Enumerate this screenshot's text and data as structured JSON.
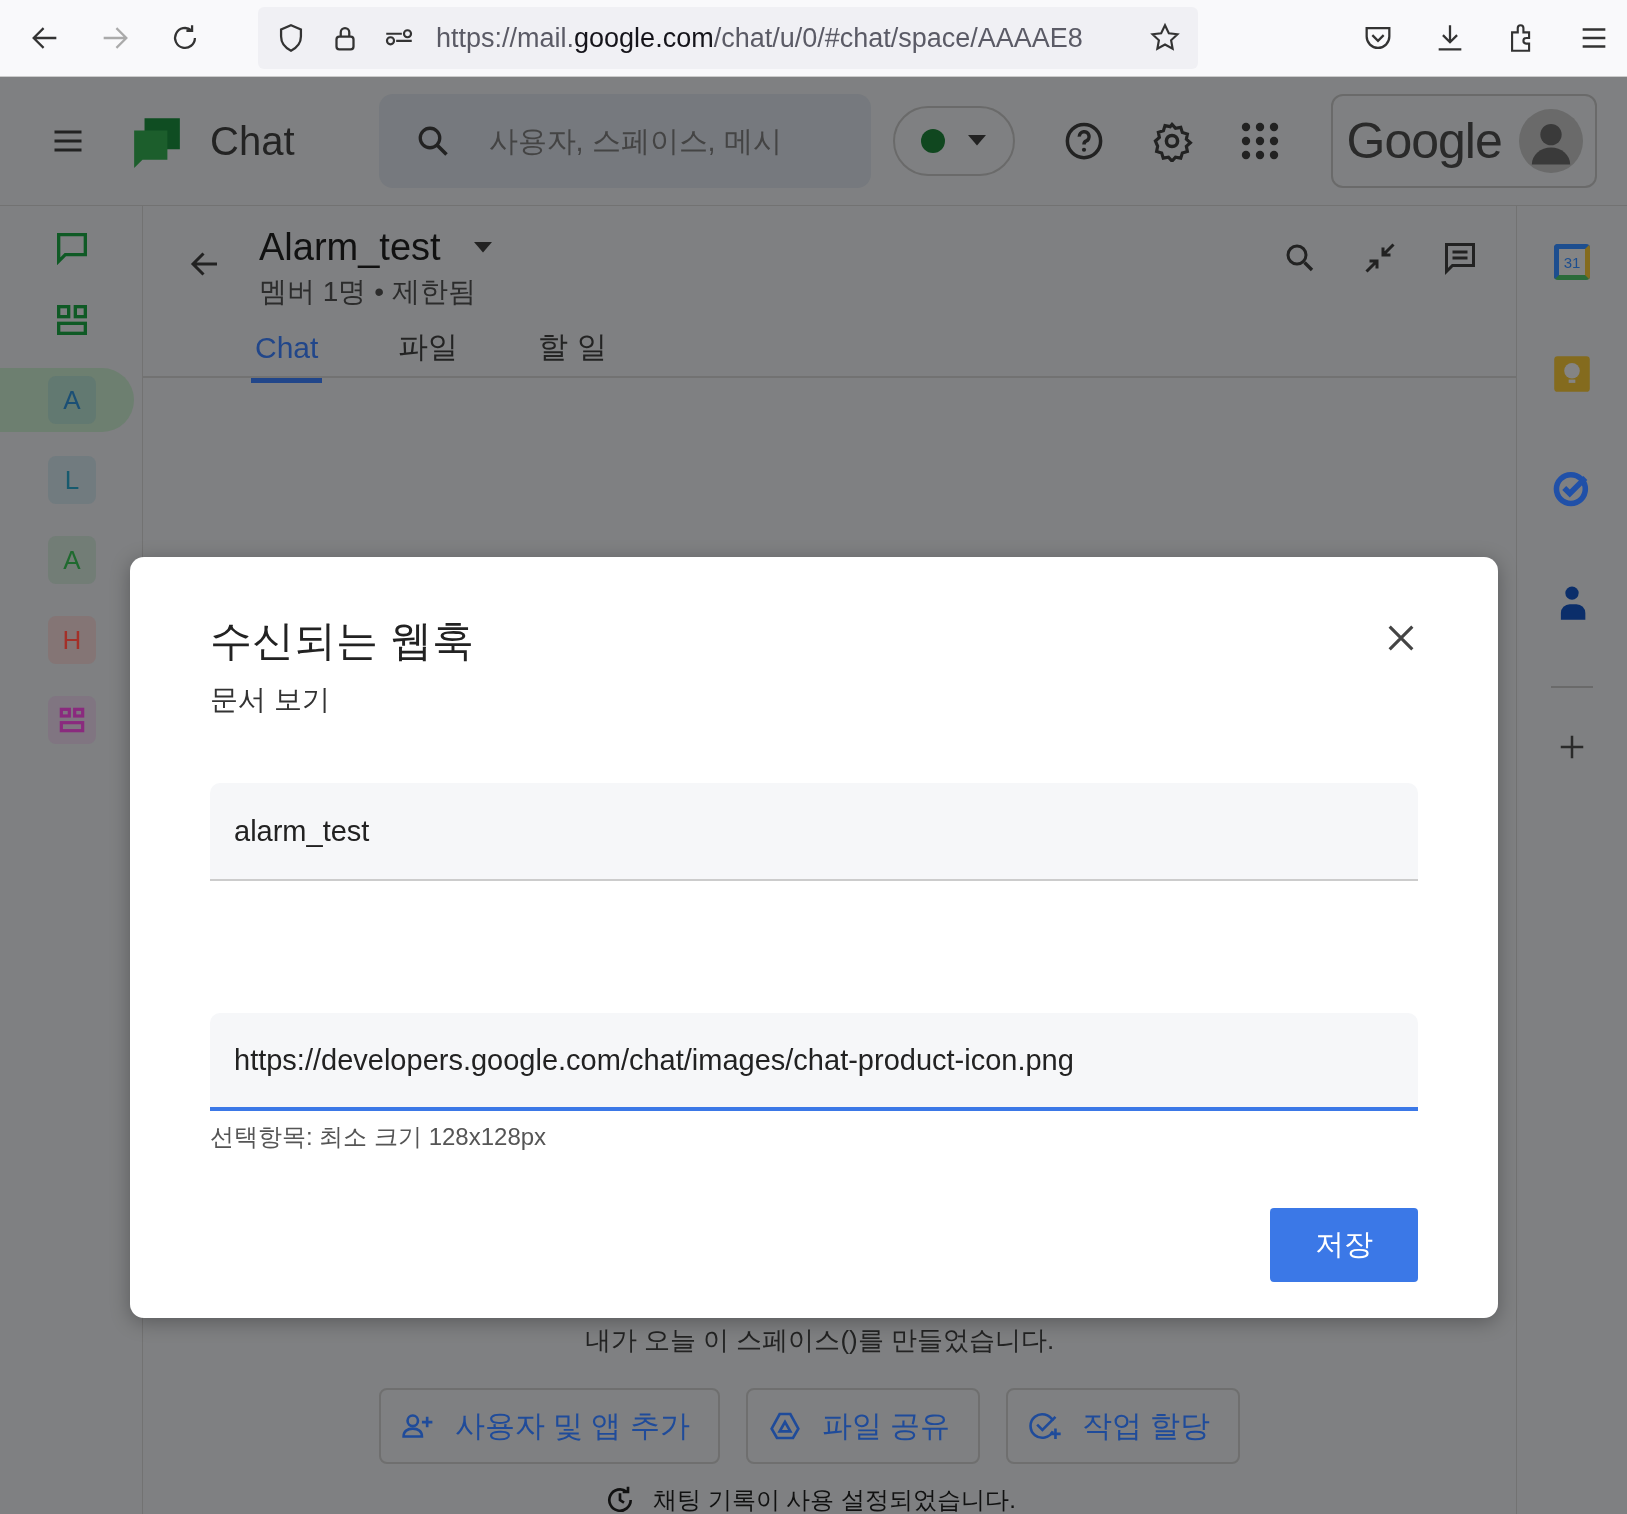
{
  "browser": {
    "url": "https://mail.**google.com**/chat/u/0/#chat/space/AAAAE8"
  },
  "header": {
    "app_name": "Chat",
    "search": {
      "placeholder": "사용자, 스페이스, 메시"
    },
    "status": {
      "color": "#10471f"
    },
    "account_logo": "Google"
  },
  "sidebar": {
    "items": [
      {
        "kind": "letter",
        "label": "A",
        "color": "#1b4f75",
        "selected": true
      },
      {
        "kind": "letter",
        "label": "L",
        "color": "#175a6e",
        "selected": false
      },
      {
        "kind": "letter",
        "label": "A",
        "color": "#1f6a2f",
        "selected": false
      },
      {
        "kind": "letter",
        "label": "H",
        "color": "#a33028",
        "selected": false
      },
      {
        "kind": "grid",
        "color": "#8a2a7e",
        "selected": false
      }
    ]
  },
  "space": {
    "title": "Alarm_test",
    "subtitle": "멤버 1명 • 제한됨",
    "tabs": [
      {
        "label": "Chat",
        "selected": true
      },
      {
        "label": "파일",
        "selected": false
      },
      {
        "label": "할 일",
        "selected": false
      }
    ],
    "created_message": "내가 오늘 이 스페이스()를 만들었습니다.",
    "actions": [
      {
        "kind": "add-people",
        "label": "사용자 및 앱 추가"
      },
      {
        "kind": "share-file",
        "label": "파일 공유"
      },
      {
        "kind": "assign-task",
        "label": "작업 할당"
      }
    ],
    "history_note": "채팅 기록이 사용 설정되었습니다."
  },
  "right_rail": {
    "calendar_day": "31"
  },
  "dialog": {
    "title": "수신되는 웹훅",
    "link": "문서 보기",
    "fields": [
      {
        "value": "alarm_test",
        "focused": false
      },
      {
        "value": "https://developers.google.com/chat/images/chat-product-icon.png",
        "focused": true,
        "helper": "선택항목: 최소 크기 128x128px"
      }
    ],
    "save_button": "저장"
  }
}
